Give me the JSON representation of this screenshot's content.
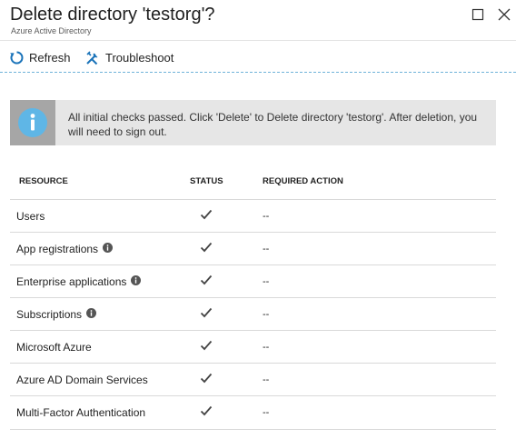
{
  "header": {
    "title": "Delete directory 'testorg'?",
    "subtitle": "Azure Active Directory",
    "maximize_icon": "maximize-icon",
    "close_icon": "close-icon"
  },
  "toolbar": {
    "refresh_label": "Refresh",
    "troubleshoot_label": "Troubleshoot",
    "refresh_icon": "refresh-icon",
    "troubleshoot_icon": "wrench-icon"
  },
  "banner": {
    "text": "All initial checks passed. Click 'Delete' to Delete directory 'testorg'. After deletion, you will need to sign out.",
    "icon": "info-icon"
  },
  "table": {
    "columns": [
      "RESOURCE",
      "STATUS",
      "REQUIRED ACTION"
    ],
    "rows": [
      {
        "resource": "Users",
        "status": "check",
        "action": "--",
        "info": false
      },
      {
        "resource": "App registrations",
        "status": "check",
        "action": "--",
        "info": true
      },
      {
        "resource": "Enterprise applications",
        "status": "check",
        "action": "--",
        "info": true
      },
      {
        "resource": "Subscriptions",
        "status": "check",
        "action": "--",
        "info": true
      },
      {
        "resource": "Microsoft Azure",
        "status": "check",
        "action": "--",
        "info": false
      },
      {
        "resource": "Azure AD Domain Services",
        "status": "check",
        "action": "--",
        "info": false
      },
      {
        "resource": "Multi-Factor Authentication",
        "status": "check",
        "action": "--",
        "info": false
      }
    ]
  },
  "colors": {
    "accent": "#1a73b9",
    "info_blue": "#5fb6e6",
    "banner_bg": "#e6e6e6",
    "banner_icon_bg": "#a6a6a6"
  }
}
